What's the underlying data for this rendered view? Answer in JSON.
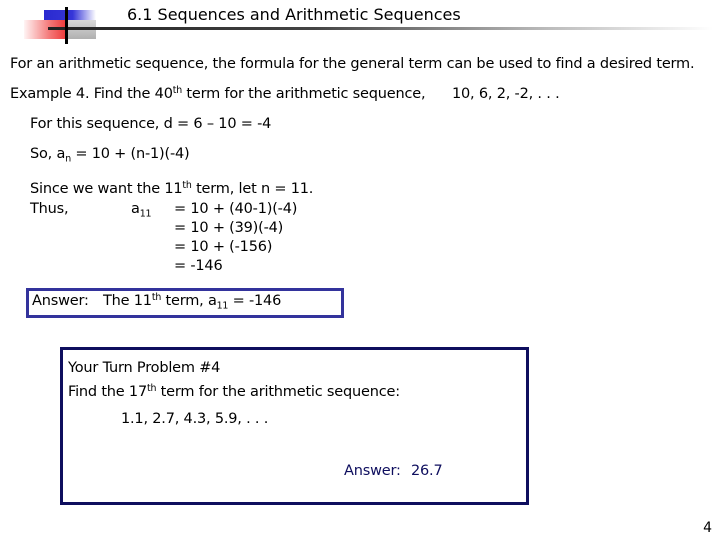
{
  "slide": {
    "title": "6.1 Sequences and Arithmetic Sequences",
    "page_number": "4",
    "colors": {
      "answer_box_border": "#33339c",
      "turn_box_border": "#0e0e5e",
      "answer_text": "#0e0e5e"
    }
  },
  "intro": "For an arithmetic sequence, the formula for the general term can be used to find a desired term.",
  "example": {
    "prefix": "Example 4.  Find the 40",
    "sup": "th",
    "suffix": " term for the arithmetic sequence,",
    "sequence": "10, 6, 2, -2, . . ."
  },
  "work": {
    "common_difference": "For this sequence, d = 6 – 10 = -4",
    "formula_prefix": "So, a",
    "formula_sub": "n",
    "formula_suffix": " = 10 + (n-1)(-4)",
    "since_prefix": "Since we want the 11",
    "since_sup": "th",
    "since_suffix": " term, let n = 11.",
    "thus_label": "Thus,",
    "a_label": "a",
    "a_sub": "11",
    "steps": [
      "= 10 + (40-1)(-4)",
      "= 10 + (39)(-4)",
      "= 10 + (-156)",
      "= -146"
    ]
  },
  "answer": {
    "label": "Answer:",
    "text_prefix": "The 11",
    "text_sup": "th",
    "text_mid": " term,  a",
    "text_sub": "11",
    "text_suffix": " =  -146"
  },
  "your_turn": {
    "heading": "Your Turn Problem #4",
    "prompt_prefix": "Find the 17",
    "prompt_sup": "th",
    "prompt_suffix": " term for the arithmetic sequence:",
    "sequence": "1.1, 2.7, 4.3, 5.9, . . .",
    "answer_label": "Answer:",
    "answer_value": "26.7"
  }
}
